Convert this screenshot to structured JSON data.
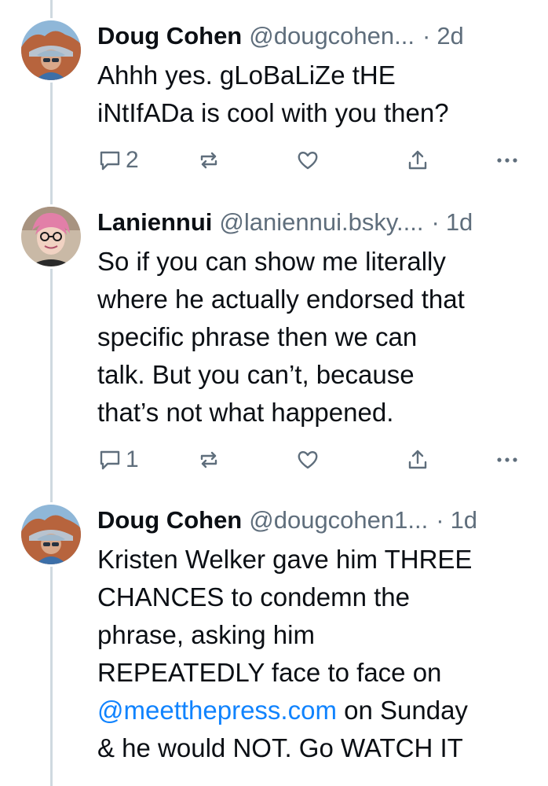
{
  "posts": [
    {
      "author": "Doug Cohen",
      "handle": "@dougcohen...",
      "time": "2d",
      "text_parts": [
        "Ahhh yes.  gLoBaLiZe tHE\niNtIfADa is cool with you then?"
      ],
      "reply_count": "2",
      "avatar": "doug-avatar"
    },
    {
      "author": "Laniennui",
      "handle": "@laniennui.bsky....",
      "time": "1d",
      "text_parts": [
        "So if you can show me literally\nwhere he actually endorsed that\nspecific phrase then we can\ntalk. But you can’t, because\nthat’s not what happened."
      ],
      "reply_count": "1",
      "avatar": "laniennui-avatar"
    },
    {
      "author": "Doug Cohen",
      "handle": "@dougcohen1...",
      "time": "1d",
      "text_before_mention": "Kristen Welker gave him THREE\nCHANCES to condemn the\nphrase, asking him\nREPEATEDLY face to face on\n",
      "mention": "@meetthepress.com",
      "text_after_mention": " on Sunday\n& he would NOT. Go WATCH IT",
      "avatar": "doug-avatar"
    }
  ],
  "separator": "·",
  "colors": {
    "text": "#0b0f14",
    "muted": "#5f6e7c",
    "link": "#1083fe",
    "thread_line": "#cfd9e0"
  },
  "icons": [
    "reply-icon",
    "repost-icon",
    "like-icon",
    "share-icon",
    "more-icon"
  ]
}
